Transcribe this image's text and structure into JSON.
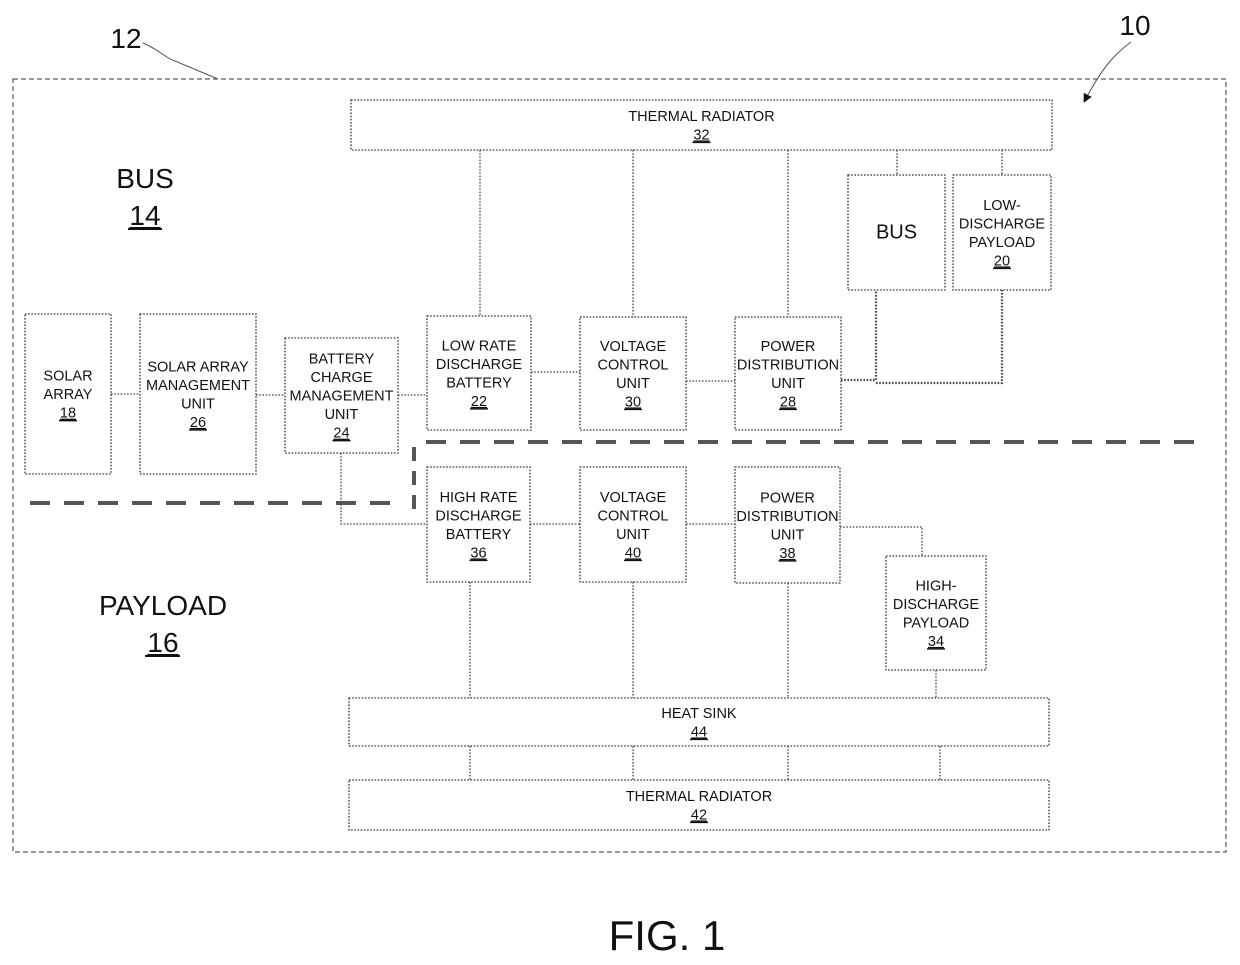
{
  "figure_label": "FIG. 1",
  "callouts": {
    "system_ref": "10",
    "enclosure_ref": "12"
  },
  "regions": {
    "bus": {
      "label": "BUS",
      "ref": "14"
    },
    "payload": {
      "label": "PAYLOAD",
      "ref": "16"
    }
  },
  "blocks": [
    {
      "id": "thermal-radiator-32",
      "lines": [
        "THERMAL RADIATOR"
      ],
      "ref": "32"
    },
    {
      "id": "bus-load",
      "lines": [
        "BUS"
      ],
      "ref": ""
    },
    {
      "id": "low-discharge-payload-20",
      "lines": [
        "LOW-",
        "DISCHARGE",
        "PAYLOAD"
      ],
      "ref": "20"
    },
    {
      "id": "solar-array-18",
      "lines": [
        "SOLAR",
        "ARRAY"
      ],
      "ref": "18"
    },
    {
      "id": "solar-array-management-unit-26",
      "lines": [
        "SOLAR ARRAY",
        "MANAGEMENT",
        "UNIT"
      ],
      "ref": "26"
    },
    {
      "id": "battery-charge-management-unit-24",
      "lines": [
        "BATTERY",
        "CHARGE",
        "MANAGEMENT",
        "UNIT"
      ],
      "ref": "24"
    },
    {
      "id": "low-rate-discharge-battery-22",
      "lines": [
        "LOW RATE",
        "DISCHARGE",
        "BATTERY"
      ],
      "ref": "22"
    },
    {
      "id": "voltage-control-unit-30",
      "lines": [
        "VOLTAGE",
        "CONTROL",
        "UNIT"
      ],
      "ref": "30"
    },
    {
      "id": "power-distribution-unit-28",
      "lines": [
        "POWER",
        "DISTRIBUTION",
        "UNIT"
      ],
      "ref": "28"
    },
    {
      "id": "high-rate-discharge-battery-36",
      "lines": [
        "HIGH RATE",
        "DISCHARGE",
        "BATTERY"
      ],
      "ref": "36"
    },
    {
      "id": "voltage-control-unit-40",
      "lines": [
        "VOLTAGE",
        "CONTROL",
        "UNIT"
      ],
      "ref": "40"
    },
    {
      "id": "power-distribution-unit-38",
      "lines": [
        "POWER",
        "DISTRIBUTION",
        "UNIT"
      ],
      "ref": "38"
    },
    {
      "id": "high-discharge-payload-34",
      "lines": [
        "HIGH-",
        "DISCHARGE",
        "PAYLOAD"
      ],
      "ref": "34"
    },
    {
      "id": "heat-sink-44",
      "lines": [
        "HEAT SINK"
      ],
      "ref": "44"
    },
    {
      "id": "thermal-radiator-42",
      "lines": [
        "THERMAL RADIATOR"
      ],
      "ref": "42"
    }
  ],
  "connections": [
    [
      "solar-array-18",
      "solar-array-management-unit-26"
    ],
    [
      "solar-array-management-unit-26",
      "battery-charge-management-unit-24"
    ],
    [
      "battery-charge-management-unit-24",
      "low-rate-discharge-battery-22"
    ],
    [
      "battery-charge-management-unit-24",
      "high-rate-discharge-battery-36"
    ],
    [
      "low-rate-discharge-battery-22",
      "voltage-control-unit-30"
    ],
    [
      "voltage-control-unit-30",
      "power-distribution-unit-28"
    ],
    [
      "power-distribution-unit-28",
      "bus-load"
    ],
    [
      "power-distribution-unit-28",
      "low-discharge-payload-20"
    ],
    [
      "thermal-radiator-32",
      "low-rate-discharge-battery-22"
    ],
    [
      "thermal-radiator-32",
      "voltage-control-unit-30"
    ],
    [
      "thermal-radiator-32",
      "power-distribution-unit-28"
    ],
    [
      "thermal-radiator-32",
      "bus-load"
    ],
    [
      "thermal-radiator-32",
      "low-discharge-payload-20"
    ],
    [
      "high-rate-discharge-battery-36",
      "voltage-control-unit-40"
    ],
    [
      "voltage-control-unit-40",
      "power-distribution-unit-38"
    ],
    [
      "power-distribution-unit-38",
      "high-discharge-payload-34"
    ],
    [
      "high-rate-discharge-battery-36",
      "heat-sink-44"
    ],
    [
      "voltage-control-unit-40",
      "heat-sink-44"
    ],
    [
      "power-distribution-unit-38",
      "heat-sink-44"
    ],
    [
      "high-discharge-payload-34",
      "heat-sink-44"
    ],
    [
      "heat-sink-44",
      "thermal-radiator-42"
    ]
  ]
}
